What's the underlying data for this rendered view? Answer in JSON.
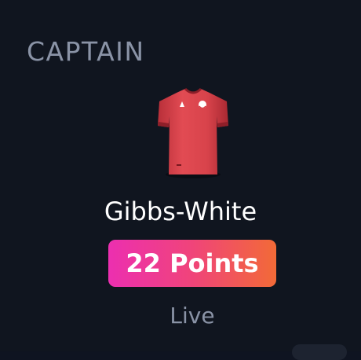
{
  "section": {
    "title": "CAPTAIN"
  },
  "player": {
    "name": "Gibbs-White",
    "points_label": "22 Points",
    "status": "Live",
    "shirt_icon": "red-shirt-icon"
  },
  "colors": {
    "background": "#10151f",
    "muted_text": "#8a93a6",
    "badge_gradient_start": "#ec2fb0",
    "badge_gradient_end": "#f26a37",
    "shirt_red": "#d9404a"
  }
}
